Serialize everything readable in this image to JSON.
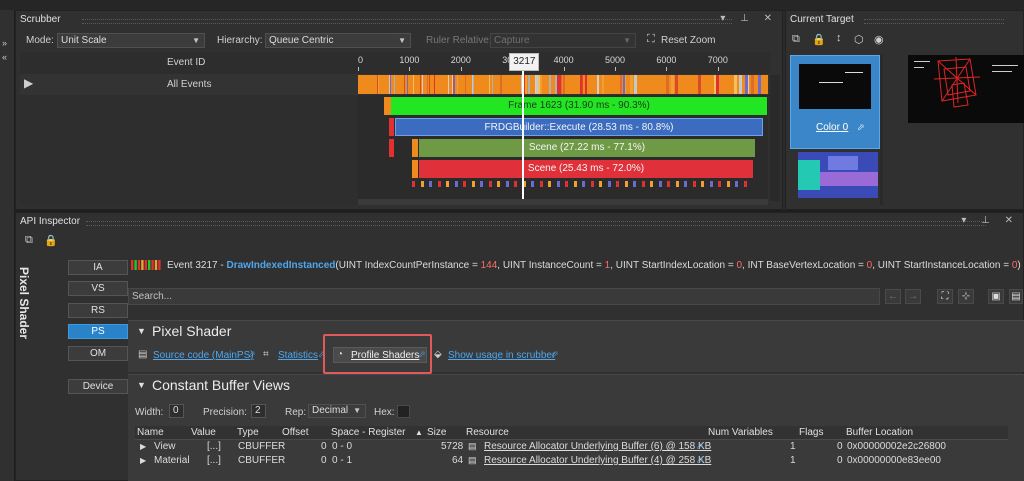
{
  "colors": {
    "accent": "#2a82c9",
    "link": "#4ea7ee",
    "frame_bar": "#22e622",
    "frdg_bar": "#3c6cc0",
    "scene_green": "#6f9a45",
    "scene_red": "#e0303a",
    "highlight": "#e05a5a"
  },
  "scrubber": {
    "title": "Scrubber",
    "mode_label": "Mode:",
    "mode_value": "Unit Scale",
    "hierarchy_label": "Hierarchy:",
    "hierarchy_value": "Queue Centric",
    "ruler_label": "Ruler Relative:",
    "ruler_value": "Capture",
    "reset_zoom": "Reset Zoom",
    "event_id_header": "Event ID",
    "all_events": "All Events",
    "ticks": [
      "0",
      "1000",
      "2000",
      "3000",
      "4000",
      "5000",
      "6000",
      "7000"
    ],
    "tick_values": [
      0,
      1000,
      2000,
      3000,
      4000,
      5000,
      6000,
      7000
    ],
    "cursor_label": "3217",
    "cursor_value": 3217,
    "bars": [
      {
        "label": "Frame 1623 (31.90 ms - 90.3%)",
        "color": "#22e622"
      },
      {
        "label": "FRDGBuilder::Execute (28.53 ms - 80.8%)",
        "color": "#3c6cc0"
      },
      {
        "label": "Scene (27.22 ms - 77.1%)",
        "color": "#6f9a45"
      },
      {
        "label": "Scene (25.43 ms - 72.0%)",
        "color": "#e0303a"
      }
    ]
  },
  "current_target": {
    "title": "Current Target",
    "color0_label": "Color 0"
  },
  "api_inspector": {
    "title": "API Inspector",
    "vertical_label": "Pixel Shader",
    "stage_buttons": [
      "IA",
      "VS",
      "RS",
      "PS",
      "OM"
    ],
    "active_stage": "PS",
    "device_button": "Device",
    "event_prefix": "Event 3217 - ",
    "event_func": "DrawIndexedInstanced",
    "event_args": [
      {
        "t": "(UINT IndexCountPerInstance = ",
        "n": false
      },
      {
        "t": "144",
        "n": true
      },
      {
        "t": ", UINT InstanceCount = ",
        "n": false
      },
      {
        "t": "1",
        "n": true
      },
      {
        "t": ", UINT StartIndexLocation = ",
        "n": false
      },
      {
        "t": "0",
        "n": true
      },
      {
        "t": ", INT BaseVertexLocation = ",
        "n": false
      },
      {
        "t": "0",
        "n": true
      },
      {
        "t": ", UINT StartInstanceLocation = ",
        "n": false
      },
      {
        "t": "0",
        "n": true
      },
      {
        "t": ")",
        "n": false
      }
    ],
    "search_placeholder": "Search...",
    "pixel_shader_section": "Pixel Shader",
    "source_code_link": "Source code (MainPS)",
    "statistics_link": "Statistics",
    "profile_shaders": "Profile Shaders",
    "show_usage_link": "Show usage in scrubber",
    "cbv_section": "Constant Buffer Views",
    "width_label": "Width:",
    "width_value": "0",
    "precision_label": "Precision:",
    "precision_value": "2",
    "rep_label": "Rep:",
    "rep_value": "Decimal",
    "hex_label": "Hex:",
    "table_headers": [
      "Name",
      "Value",
      "Type",
      "Offset",
      "Space - Register",
      "Size",
      "Resource",
      "Num Variables",
      "Flags",
      "Buffer Location"
    ],
    "rows": [
      {
        "name": "View",
        "value": "[...]",
        "type": "CBUFFER",
        "offset": "0",
        "space_register": "0 - 0",
        "size": "5728",
        "resource": "Resource Allocator Underlying Buffer (6) @ 158 KB",
        "num_variables": "1",
        "flags": "0",
        "buffer_location": "0x00000002e2c26800"
      },
      {
        "name": "Material",
        "value": "[...]",
        "type": "CBUFFER",
        "offset": "0",
        "space_register": "0 - 1",
        "size": "64",
        "resource": "Resource Allocator Underlying Buffer (4) @ 258 KB",
        "num_variables": "1",
        "flags": "0",
        "buffer_location": "0x00000000e83ee00"
      }
    ]
  }
}
